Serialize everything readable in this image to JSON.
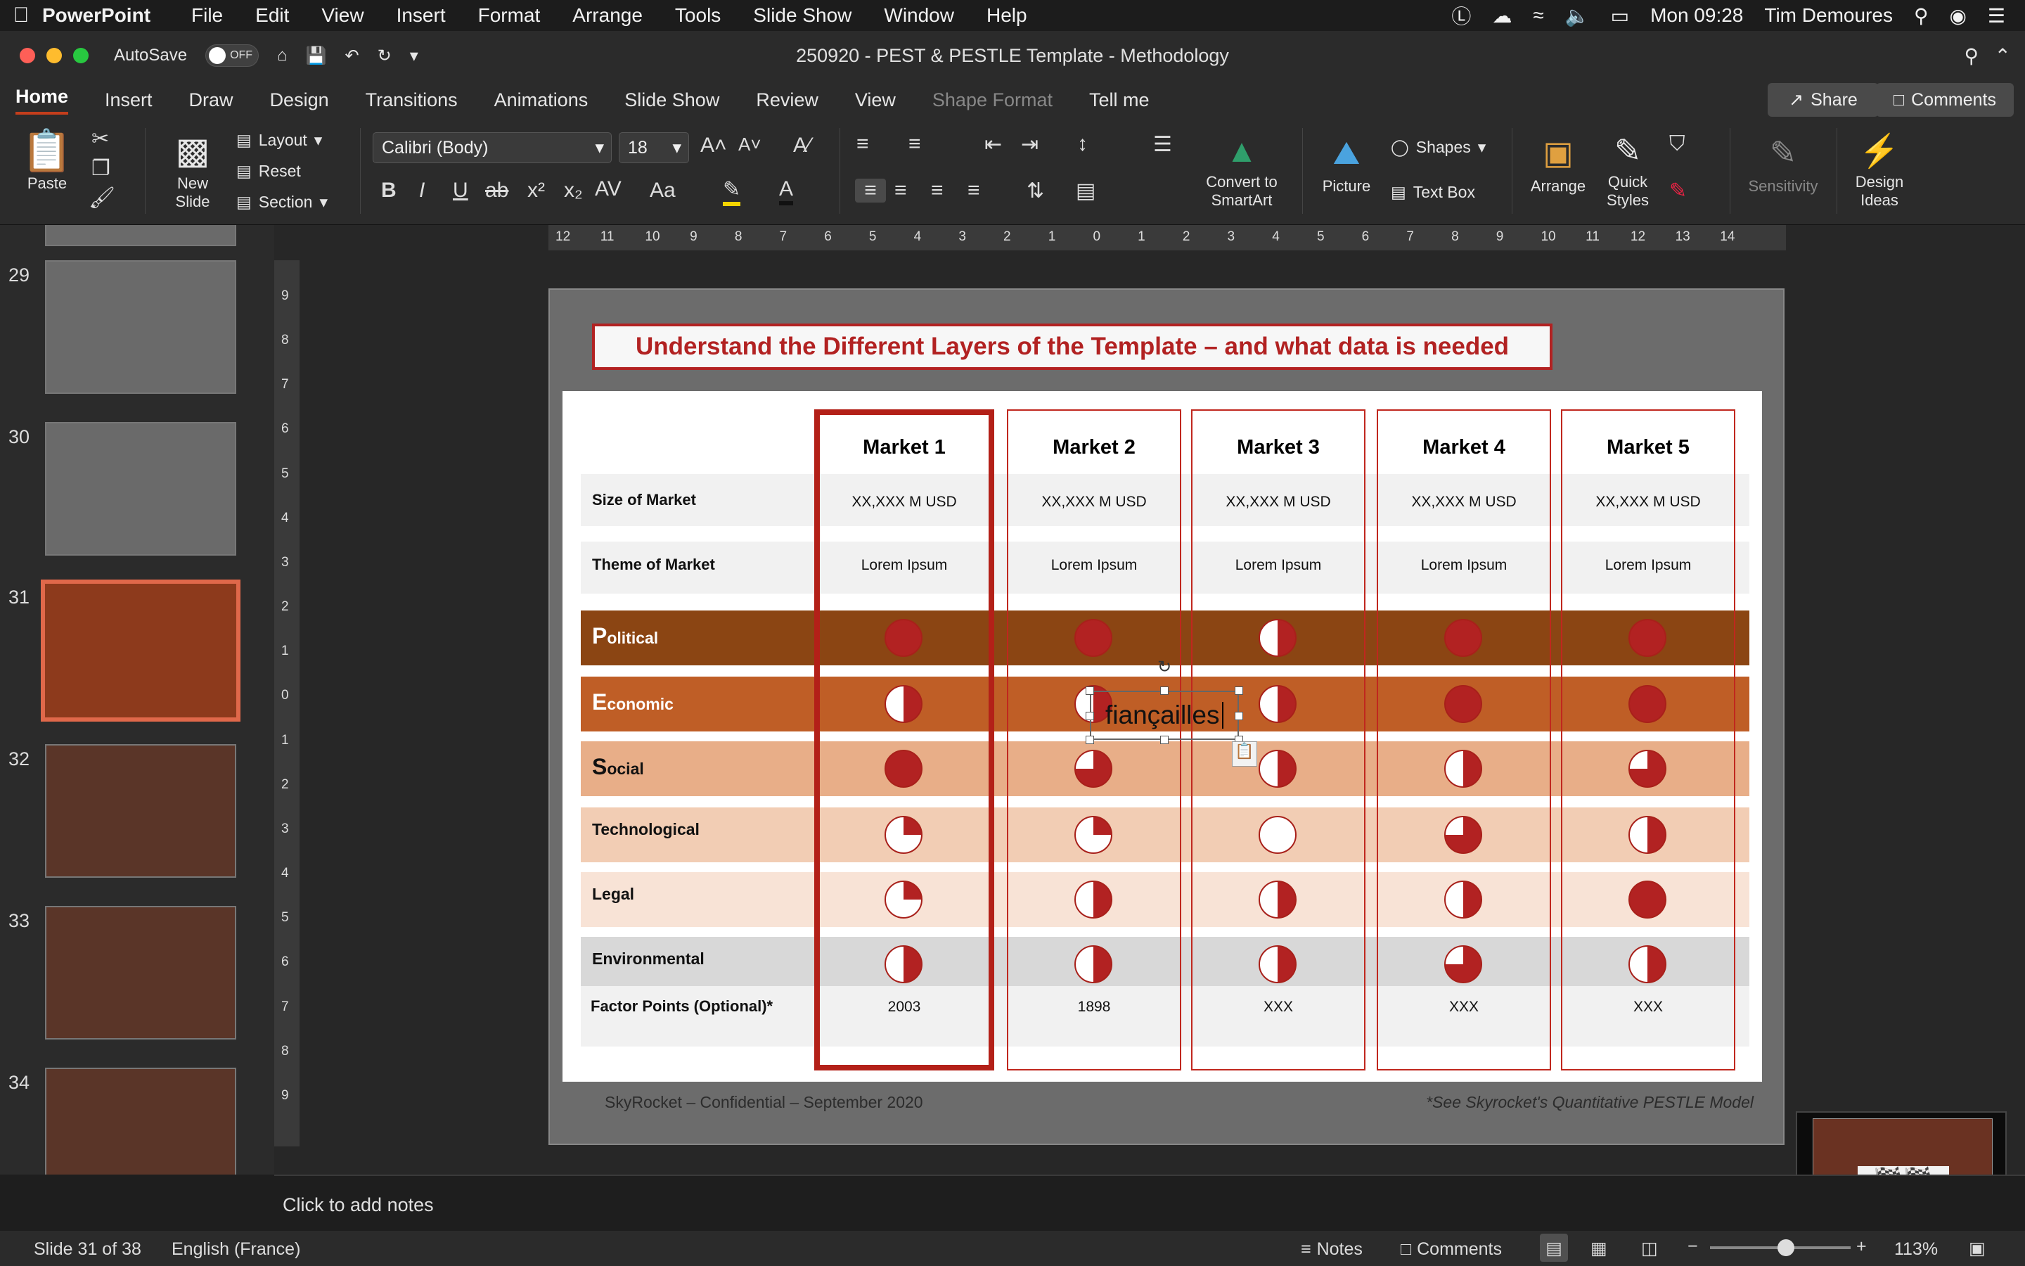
{
  "menubar": {
    "app": "PowerPoint",
    "items": [
      "File",
      "Edit",
      "View",
      "Insert",
      "Format",
      "Arrange",
      "Tools",
      "Slide Show",
      "Window",
      "Help"
    ],
    "clock": "Mon 09:28",
    "user": "Tim Demoures"
  },
  "titlebar": {
    "autosave": "AutoSave",
    "autosave_state": "OFF",
    "doc_title": "250920 - PEST & PESTLE Template - Methodology"
  },
  "tabs": [
    "Home",
    "Insert",
    "Draw",
    "Design",
    "Transitions",
    "Animations",
    "Slide Show",
    "Review",
    "View",
    "Shape Format",
    "Tell me"
  ],
  "share": "Share",
  "comments": "Comments",
  "ribbon": {
    "paste": "Paste",
    "new_slide_1": "New",
    "new_slide_2": "Slide",
    "layout": "Layout",
    "reset": "Reset",
    "section": "Section",
    "font_name": "Calibri (Body)",
    "font_size": "18",
    "convert_1": "Convert to",
    "convert_2": "SmartArt",
    "picture": "Picture",
    "shapes": "Shapes",
    "text_box": "Text Box",
    "arrange": "Arrange",
    "quick_1": "Quick",
    "quick_2": "Styles",
    "sensitivity": "Sensitivity",
    "design_1": "Design",
    "design_2": "Ideas"
  },
  "thumbs": [
    "29",
    "30",
    "31",
    "32",
    "33",
    "34"
  ],
  "hruler_labels": [
    "12",
    "11",
    "10",
    "9",
    "8",
    "7",
    "6",
    "5",
    "4",
    "3",
    "2",
    "1",
    "0",
    "1",
    "2",
    "3",
    "4",
    "5",
    "6",
    "7",
    "8",
    "9",
    "10",
    "11",
    "12",
    "13",
    "14"
  ],
  "vruler_labels": [
    "9",
    "8",
    "7",
    "6",
    "5",
    "4",
    "3",
    "2",
    "1",
    "0",
    "1",
    "2",
    "3",
    "4",
    "5",
    "6",
    "7",
    "8",
    "9"
  ],
  "slide": {
    "title": "Understand the Different Layers of the Template – and what data is needed",
    "markets": [
      "Market 1",
      "Market 2",
      "Market 3",
      "Market 4",
      "Market 5"
    ],
    "size_label": "Size of Market",
    "size_values": [
      "XX,XXX M USD",
      "XX,XXX M USD",
      "XX,XXX M USD",
      "XX,XXX M USD",
      "XX,XXX M USD"
    ],
    "theme_label": "Theme of Market",
    "theme_values": [
      "Lorem Ipsum",
      "Lorem Ipsum",
      "Lorem Ipsum",
      "Lorem Ipsum",
      "Lorem Ipsum"
    ],
    "factors": [
      {
        "cap": "P",
        "rest": "olitical",
        "band": "#8b4513",
        "white": true
      },
      {
        "cap": "E",
        "rest": "conomic",
        "band": "#bf5e26",
        "white": true
      },
      {
        "cap": "S",
        "rest": "ocial",
        "band": "#e8ae88",
        "white": false
      },
      {
        "cap": "",
        "rest": "Technological",
        "band": "#f2cdb4",
        "white": false
      },
      {
        "cap": "",
        "rest": "Legal",
        "band": "#f8e3d6",
        "white": false
      },
      {
        "cap": "",
        "rest": "Environmental",
        "band": "#d8d8d8",
        "white": false
      }
    ],
    "scores": [
      [
        1,
        1,
        0.5,
        1,
        1
      ],
      [
        0.5,
        0.5,
        0.5,
        1,
        1
      ],
      [
        1,
        0.75,
        0.5,
        0.5,
        0.75
      ],
      [
        0.25,
        0.25,
        0,
        0.75,
        0.5
      ],
      [
        0.25,
        0.5,
        0.5,
        0.5,
        1
      ],
      [
        0.5,
        0.5,
        0.5,
        0.75,
        0.5
      ]
    ],
    "points_label": "Factor Points (Optional)*",
    "points_values": [
      "2003",
      "1898",
      "XXX",
      "XXX",
      "XXX"
    ],
    "editing_text": "fiançailles",
    "footer_left": "SkyRocket – Confidential – September 2020",
    "footer_right": "*See Skyrocket's Quantitative PESTLE Model"
  },
  "notes_placeholder": "Click to add notes",
  "status": {
    "slide": "Slide 31 of 38",
    "language": "English (France)",
    "notes": "Notes",
    "comments": "Comments",
    "zoom": "113%"
  },
  "colors": {
    "accent": "#c43e1c",
    "market_red": "#b32018",
    "pie_red": "#b22222"
  }
}
